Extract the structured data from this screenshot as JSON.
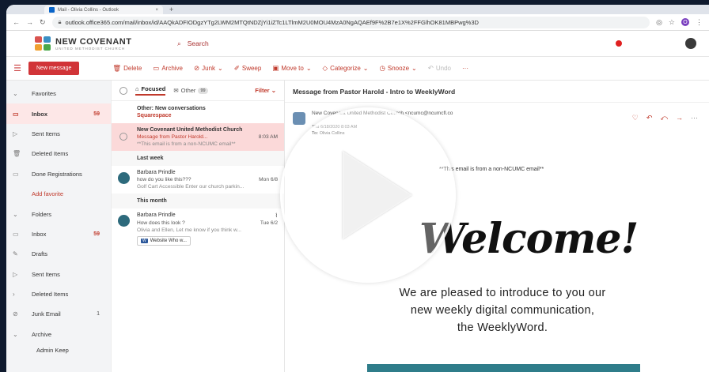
{
  "browser": {
    "tab_title": "Mail - Olivia Collins - Outlook",
    "tab_close": "×",
    "new_tab": "+",
    "url": "outlook.office365.com/mail/inbox/id/AAQkADFIODgzYTg2LWM2MTQtNDZjYi1iZTc1LTlmM2U0MOU4MzA0NgAQAEf9F%2B7e1X%2FFGlhOK81MBPwg%3D",
    "ext_initial": "O"
  },
  "header": {
    "org_name": "NEW COVENANT",
    "org_sub": "UNITED METHODIST CHURCH",
    "search_label": "Search"
  },
  "commands": {
    "new_message": "New message",
    "delete": "Delete",
    "archive": "Archive",
    "junk": "Junk",
    "sweep": "Sweep",
    "move_to": "Move to",
    "categorize": "Categorize",
    "snooze": "Snooze",
    "undo": "Undo",
    "more": "···"
  },
  "nav": {
    "favorites": "Favorites",
    "inbox": "Inbox",
    "inbox_count": "59",
    "sent_items": "Sent Items",
    "deleted_items": "Deleted Items",
    "done_registrations": "Done Registrations",
    "add_favorite": "Add favorite",
    "folders": "Folders",
    "inbox2": "Inbox",
    "inbox2_count": "59",
    "drafts": "Drafts",
    "sent_items2": "Sent Items",
    "deleted_items2": "Deleted Items",
    "junk_email": "Junk Email",
    "junk_count": "1",
    "archive": "Archive",
    "admin_keep": "Admin Keep"
  },
  "list": {
    "focused": "Focused",
    "other": "Other",
    "other_count": "99",
    "filter": "Filter",
    "other_banner_title": "Other: New conversations",
    "other_banner_sender": "Squarespace",
    "messages": [
      {
        "from": "New Covenant United Methodist Church",
        "subject": "Message from Pastor Harold...",
        "time": "8:03 AM",
        "preview": "**This email is from a non-NCUMC email**"
      },
      {
        "from": "Barbara Prindle",
        "subject": "how do you like this???",
        "time": "Mon 6/8",
        "preview": "Golf Cart Accessible Enter our church parkin..."
      },
      {
        "from": "Barbara Prindle",
        "subject": "How does this look ?",
        "time": "Tue 6/2",
        "preview": "Olivia and Ellen, Let me know if you think w...",
        "attachment": "Website Who w..."
      }
    ],
    "group_last_week": "Last week",
    "group_this_month": "This month"
  },
  "reading": {
    "subject": "Message from Pastor Harold - Intro to WeeklyWord",
    "from": "New Covenant United Methodist Church <ncumc@ncumcfl.co",
    "date": "Thu 6/18/2020 8:03 AM",
    "to_label": "To:",
    "to": "Olivia Collins",
    "external_notice": "**This email is from a non-NCUMC email**",
    "welcome": "Welcome!",
    "intro_line1": "We are pleased to introduce to you our",
    "intro_line2": "new weekly digital communication,",
    "intro_line3": "the WeeklyWord."
  },
  "colors": {
    "accent": "#c0392b",
    "new_message_bg": "#d13438",
    "selected_row": "#fbd9d9",
    "teal": "#2f7d8a"
  }
}
